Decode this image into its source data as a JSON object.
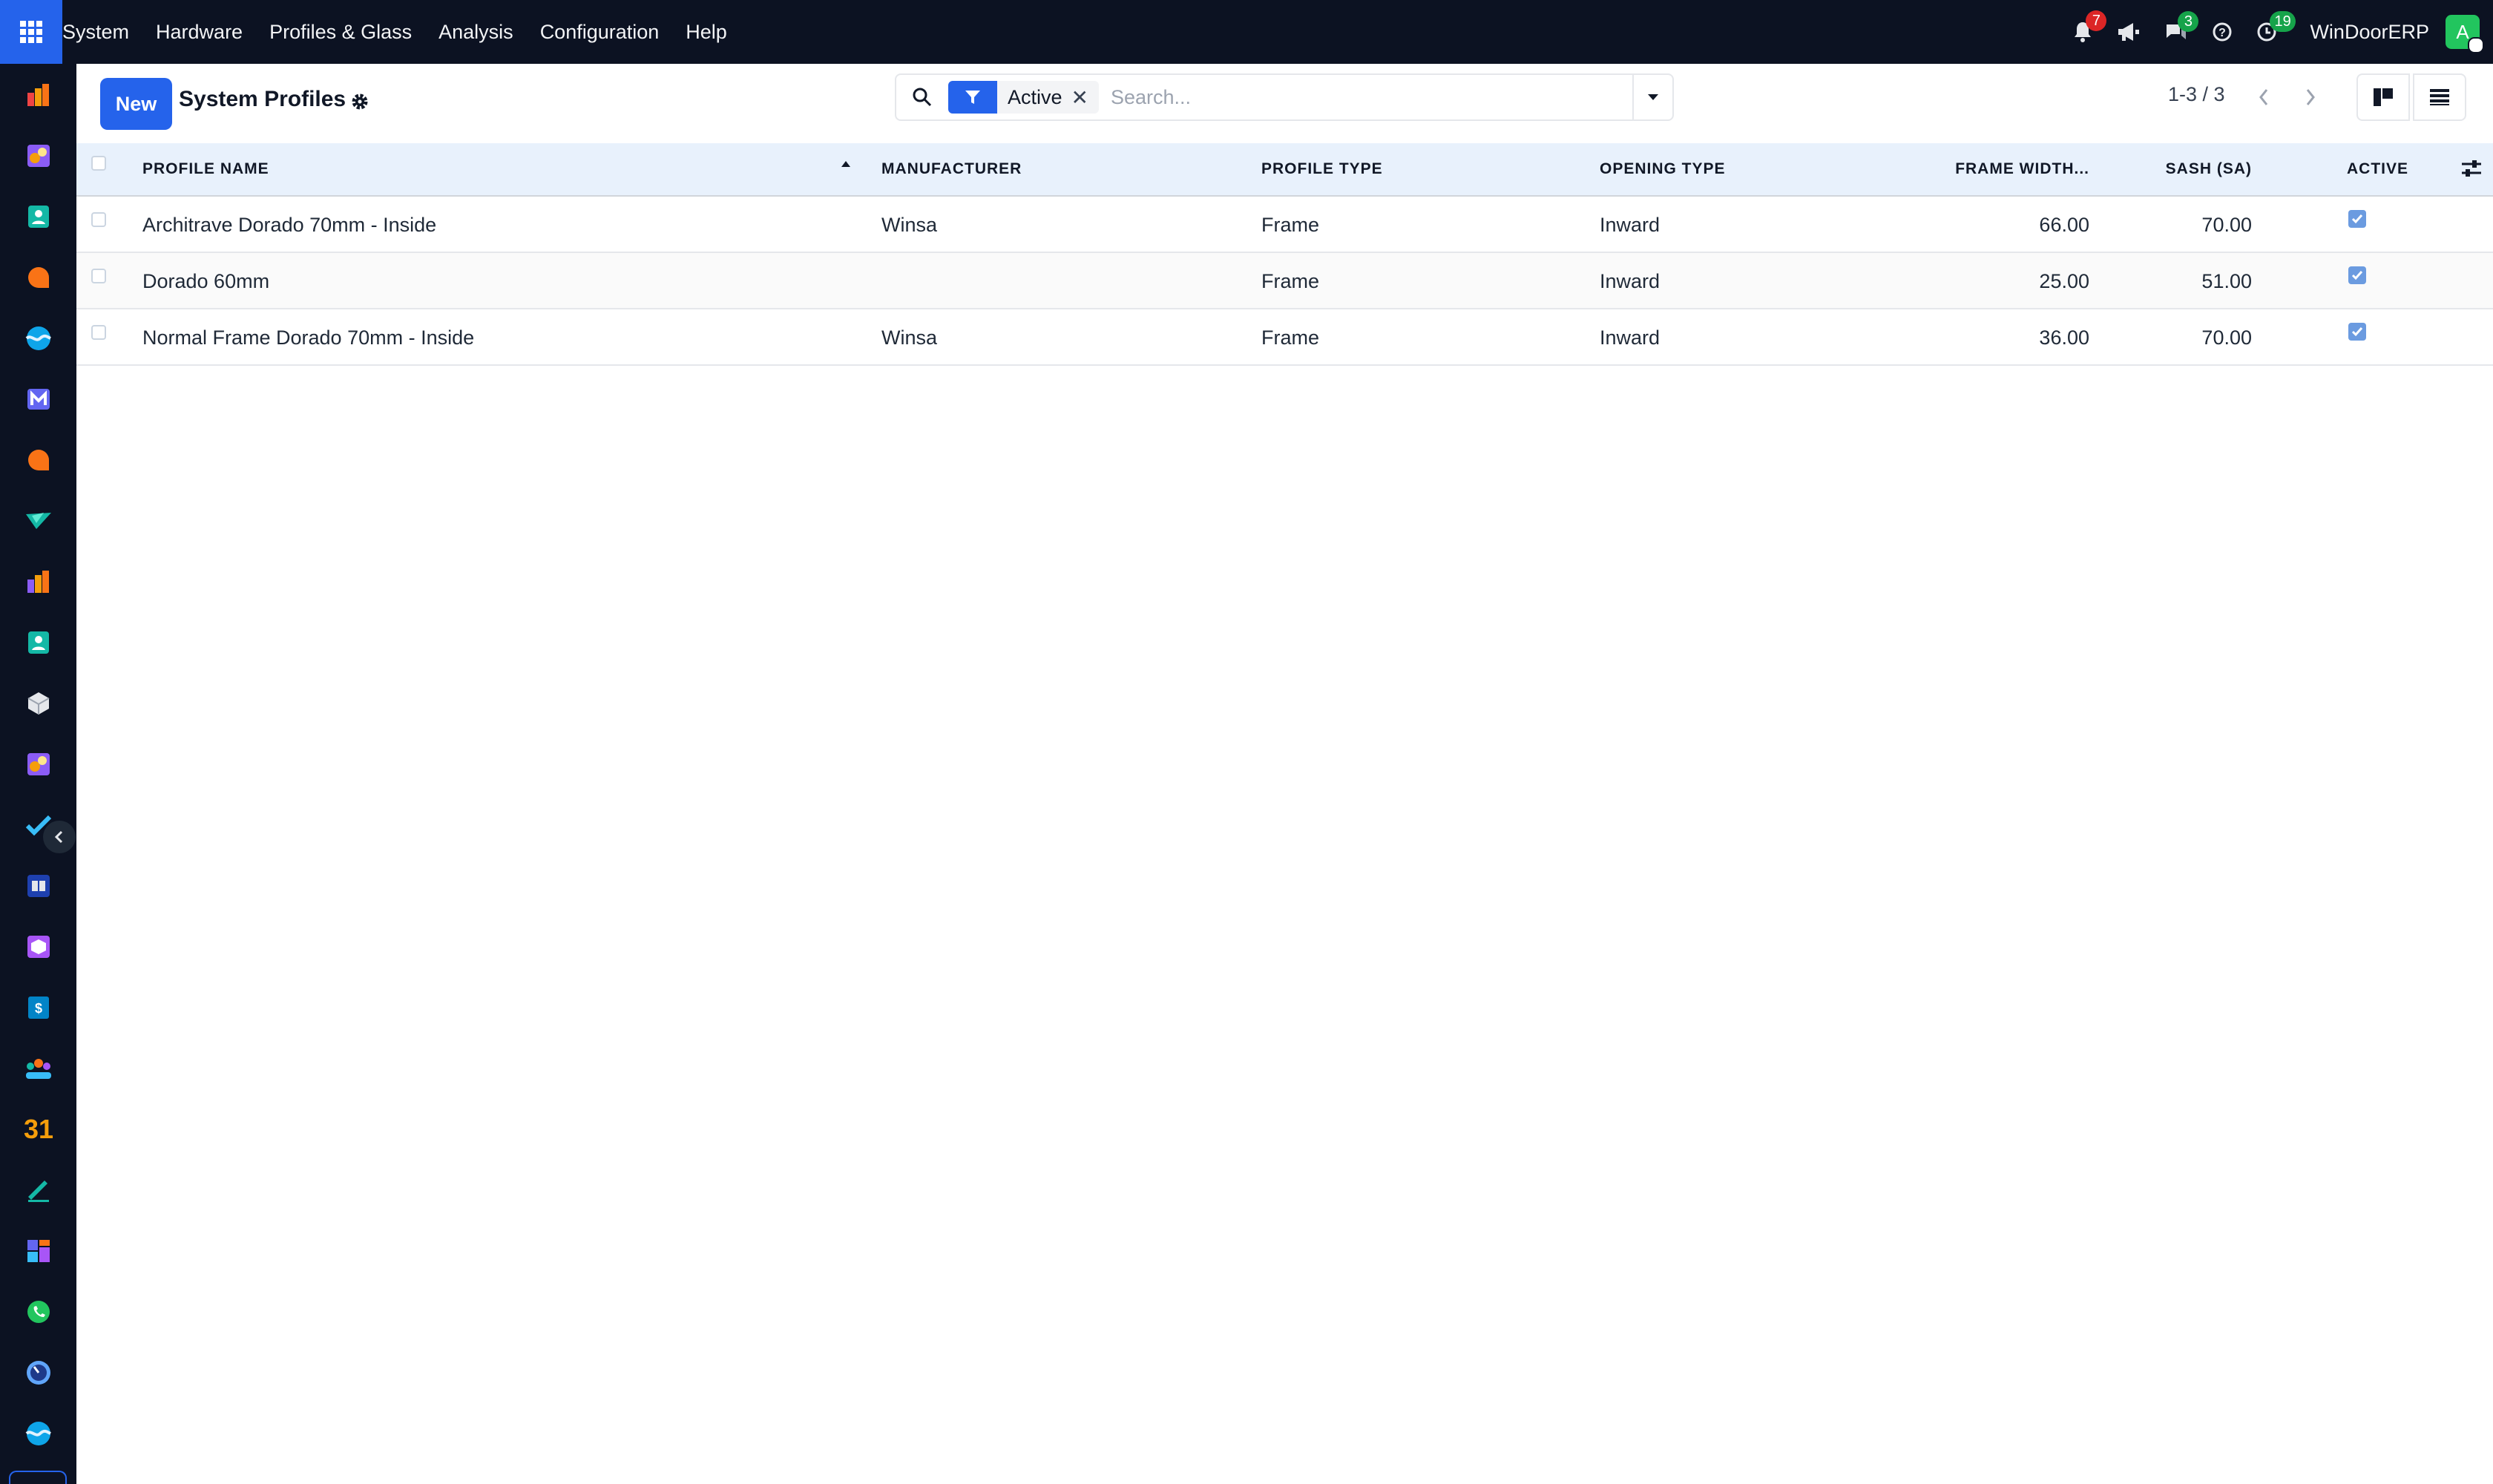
{
  "topbar": {
    "menu": [
      "System",
      "Hardware",
      "Profiles & Glass",
      "Analysis",
      "Configuration",
      "Help"
    ],
    "notifications_count": "7",
    "messages_count": "3",
    "activities_count": "19",
    "company": "WinDoorERP",
    "avatar_initial": "A"
  },
  "sidebar": {
    "apps": [
      "reporting-icon",
      "app-icon",
      "contacts-icon",
      "discuss-icon",
      "wave-icon",
      "mail-icon",
      "chat-icon",
      "check-icon",
      "charts-icon",
      "contacts-icon",
      "package-icon",
      "app-icon",
      "tasks-icon",
      "documentation-icon",
      "inventory-icon",
      "accounting-icon",
      "employees-icon",
      "calendar-icon",
      "sign-icon",
      "dashboards-icon",
      "whatsapp-icon",
      "time-icon",
      "wave-icon"
    ],
    "calendar_text": "31"
  },
  "control": {
    "new_label": "New",
    "title": "System Profiles",
    "filter_facet": "Active",
    "search_placeholder": "Search...",
    "pager": "1-3 / 3"
  },
  "table": {
    "columns": {
      "name": "PROFILE NAME",
      "manufacturer": "MANUFACTURER",
      "type": "PROFILE TYPE",
      "opening": "OPENING TYPE",
      "frame": "FRAME WIDTH...",
      "sash": "SASH (SA)",
      "active": "ACTIVE"
    },
    "rows": [
      {
        "name": "Architrave Dorado 70mm - Inside",
        "manufacturer": "Winsa",
        "type": "Frame",
        "opening": "Inward",
        "frame": "66.00",
        "sash": "70.00",
        "active": true
      },
      {
        "name": "Dorado 60mm",
        "manufacturer": "",
        "type": "Frame",
        "opening": "Inward",
        "frame": "25.00",
        "sash": "51.00",
        "active": true
      },
      {
        "name": "Normal Frame Dorado 70mm - Inside",
        "manufacturer": "Winsa",
        "type": "Frame",
        "opening": "Inward",
        "frame": "36.00",
        "sash": "70.00",
        "active": true
      }
    ]
  },
  "colors": {
    "topbar_bg": "#0c1222",
    "accent": "#2563eb",
    "header_bg": "#e8f1fc"
  }
}
